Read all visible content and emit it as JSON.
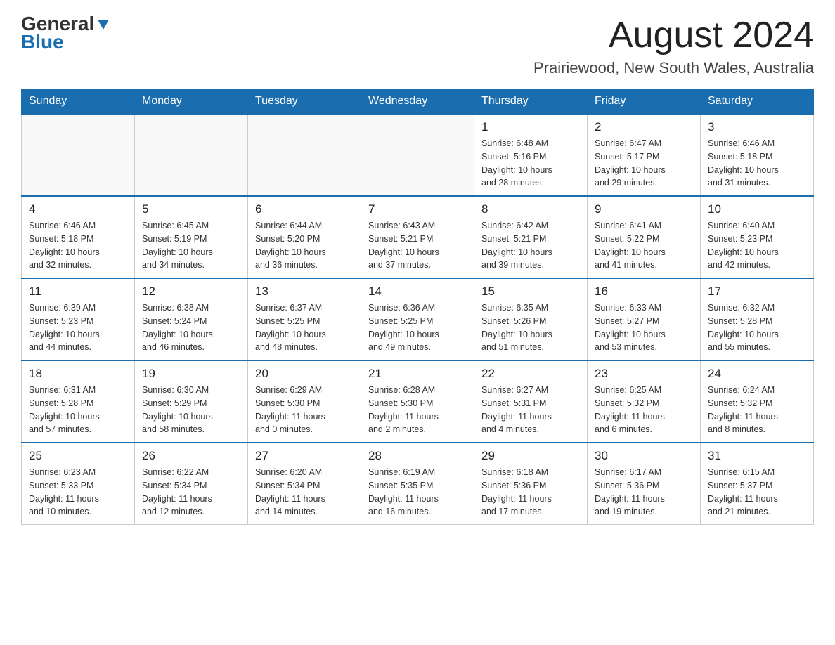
{
  "header": {
    "logo_part1": "General",
    "logo_part2": "Blue",
    "month_title": "August 2024",
    "location": "Prairiewood, New South Wales, Australia"
  },
  "weekdays": [
    "Sunday",
    "Monday",
    "Tuesday",
    "Wednesday",
    "Thursday",
    "Friday",
    "Saturday"
  ],
  "weeks": [
    [
      {
        "day": "",
        "info": ""
      },
      {
        "day": "",
        "info": ""
      },
      {
        "day": "",
        "info": ""
      },
      {
        "day": "",
        "info": ""
      },
      {
        "day": "1",
        "info": "Sunrise: 6:48 AM\nSunset: 5:16 PM\nDaylight: 10 hours\nand 28 minutes."
      },
      {
        "day": "2",
        "info": "Sunrise: 6:47 AM\nSunset: 5:17 PM\nDaylight: 10 hours\nand 29 minutes."
      },
      {
        "day": "3",
        "info": "Sunrise: 6:46 AM\nSunset: 5:18 PM\nDaylight: 10 hours\nand 31 minutes."
      }
    ],
    [
      {
        "day": "4",
        "info": "Sunrise: 6:46 AM\nSunset: 5:18 PM\nDaylight: 10 hours\nand 32 minutes."
      },
      {
        "day": "5",
        "info": "Sunrise: 6:45 AM\nSunset: 5:19 PM\nDaylight: 10 hours\nand 34 minutes."
      },
      {
        "day": "6",
        "info": "Sunrise: 6:44 AM\nSunset: 5:20 PM\nDaylight: 10 hours\nand 36 minutes."
      },
      {
        "day": "7",
        "info": "Sunrise: 6:43 AM\nSunset: 5:21 PM\nDaylight: 10 hours\nand 37 minutes."
      },
      {
        "day": "8",
        "info": "Sunrise: 6:42 AM\nSunset: 5:21 PM\nDaylight: 10 hours\nand 39 minutes."
      },
      {
        "day": "9",
        "info": "Sunrise: 6:41 AM\nSunset: 5:22 PM\nDaylight: 10 hours\nand 41 minutes."
      },
      {
        "day": "10",
        "info": "Sunrise: 6:40 AM\nSunset: 5:23 PM\nDaylight: 10 hours\nand 42 minutes."
      }
    ],
    [
      {
        "day": "11",
        "info": "Sunrise: 6:39 AM\nSunset: 5:23 PM\nDaylight: 10 hours\nand 44 minutes."
      },
      {
        "day": "12",
        "info": "Sunrise: 6:38 AM\nSunset: 5:24 PM\nDaylight: 10 hours\nand 46 minutes."
      },
      {
        "day": "13",
        "info": "Sunrise: 6:37 AM\nSunset: 5:25 PM\nDaylight: 10 hours\nand 48 minutes."
      },
      {
        "day": "14",
        "info": "Sunrise: 6:36 AM\nSunset: 5:25 PM\nDaylight: 10 hours\nand 49 minutes."
      },
      {
        "day": "15",
        "info": "Sunrise: 6:35 AM\nSunset: 5:26 PM\nDaylight: 10 hours\nand 51 minutes."
      },
      {
        "day": "16",
        "info": "Sunrise: 6:33 AM\nSunset: 5:27 PM\nDaylight: 10 hours\nand 53 minutes."
      },
      {
        "day": "17",
        "info": "Sunrise: 6:32 AM\nSunset: 5:28 PM\nDaylight: 10 hours\nand 55 minutes."
      }
    ],
    [
      {
        "day": "18",
        "info": "Sunrise: 6:31 AM\nSunset: 5:28 PM\nDaylight: 10 hours\nand 57 minutes."
      },
      {
        "day": "19",
        "info": "Sunrise: 6:30 AM\nSunset: 5:29 PM\nDaylight: 10 hours\nand 58 minutes."
      },
      {
        "day": "20",
        "info": "Sunrise: 6:29 AM\nSunset: 5:30 PM\nDaylight: 11 hours\nand 0 minutes."
      },
      {
        "day": "21",
        "info": "Sunrise: 6:28 AM\nSunset: 5:30 PM\nDaylight: 11 hours\nand 2 minutes."
      },
      {
        "day": "22",
        "info": "Sunrise: 6:27 AM\nSunset: 5:31 PM\nDaylight: 11 hours\nand 4 minutes."
      },
      {
        "day": "23",
        "info": "Sunrise: 6:25 AM\nSunset: 5:32 PM\nDaylight: 11 hours\nand 6 minutes."
      },
      {
        "day": "24",
        "info": "Sunrise: 6:24 AM\nSunset: 5:32 PM\nDaylight: 11 hours\nand 8 minutes."
      }
    ],
    [
      {
        "day": "25",
        "info": "Sunrise: 6:23 AM\nSunset: 5:33 PM\nDaylight: 11 hours\nand 10 minutes."
      },
      {
        "day": "26",
        "info": "Sunrise: 6:22 AM\nSunset: 5:34 PM\nDaylight: 11 hours\nand 12 minutes."
      },
      {
        "day": "27",
        "info": "Sunrise: 6:20 AM\nSunset: 5:34 PM\nDaylight: 11 hours\nand 14 minutes."
      },
      {
        "day": "28",
        "info": "Sunrise: 6:19 AM\nSunset: 5:35 PM\nDaylight: 11 hours\nand 16 minutes."
      },
      {
        "day": "29",
        "info": "Sunrise: 6:18 AM\nSunset: 5:36 PM\nDaylight: 11 hours\nand 17 minutes."
      },
      {
        "day": "30",
        "info": "Sunrise: 6:17 AM\nSunset: 5:36 PM\nDaylight: 11 hours\nand 19 minutes."
      },
      {
        "day": "31",
        "info": "Sunrise: 6:15 AM\nSunset: 5:37 PM\nDaylight: 11 hours\nand 21 minutes."
      }
    ]
  ]
}
